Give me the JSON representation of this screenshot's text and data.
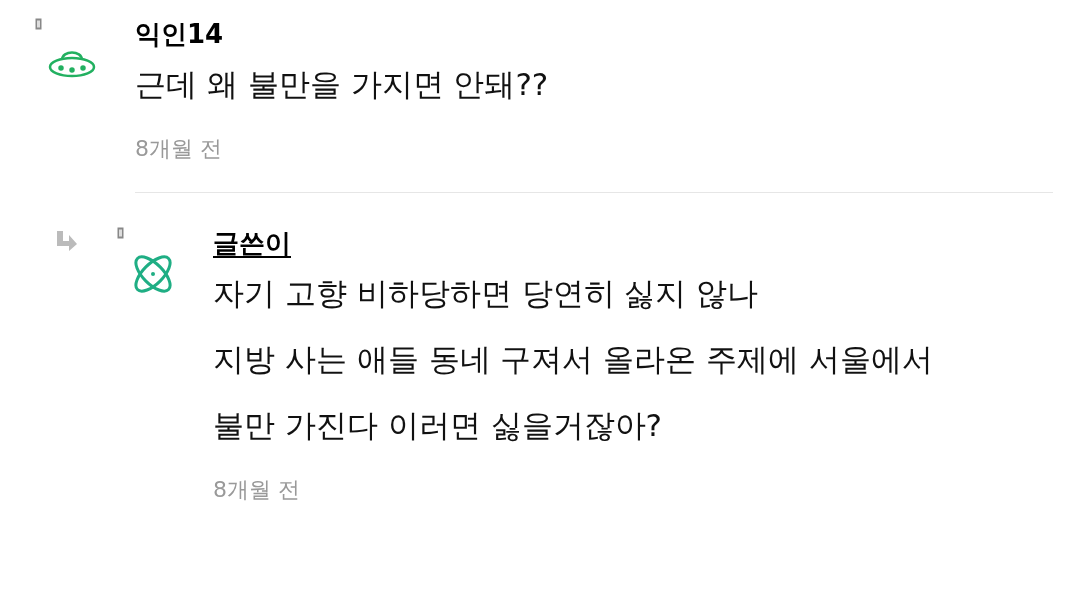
{
  "comments": [
    {
      "avatar": {
        "kind": "ufo"
      },
      "author": "익인14",
      "is_writer": false,
      "lines": [
        "근데 왜 불만을 가지면 안돼??"
      ],
      "time": "8개월 전",
      "replies": [
        {
          "avatar": {
            "kind": "atom"
          },
          "author": "글쓴이",
          "is_writer": true,
          "lines": [
            "자기 고향 비하당하면 당연히 싫지 않나",
            "지방 사는 애들 동네 구져서 올라온 주제에 서울에서",
            "불만 가진다 이러면 싫을거잖아?"
          ],
          "time": "8개월 전"
        }
      ]
    }
  ]
}
